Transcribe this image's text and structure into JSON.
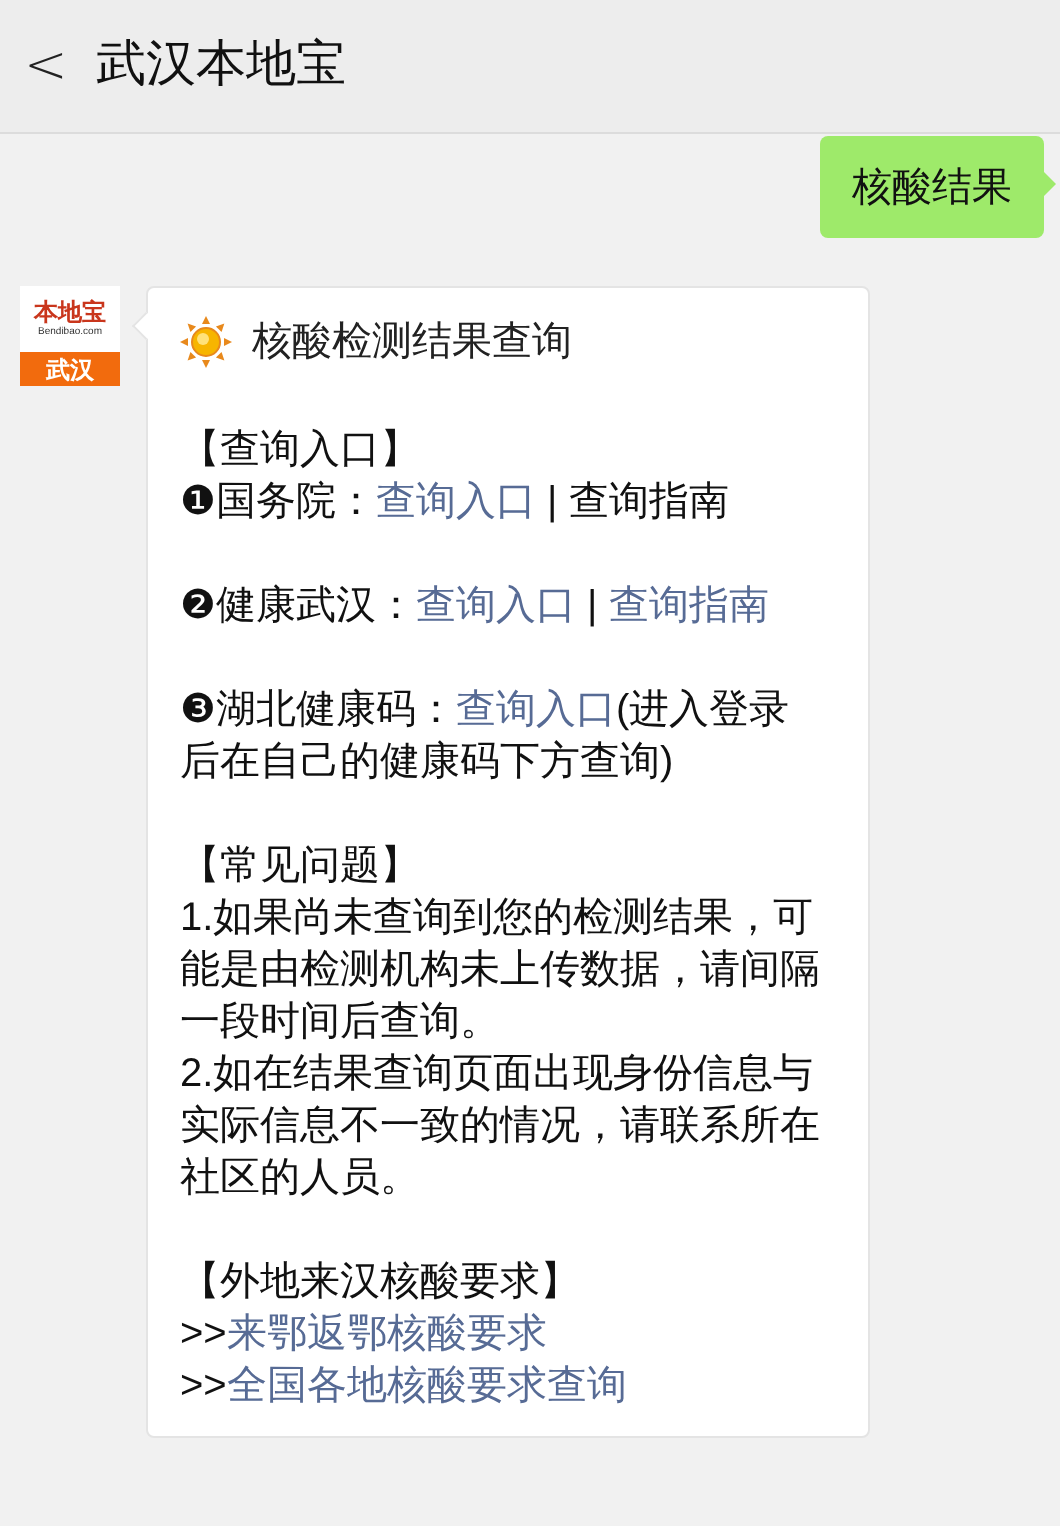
{
  "header": {
    "back": "<",
    "title": "武汉本地宝"
  },
  "messages": [
    {
      "kind": "outgoing",
      "text": "核酸结果"
    },
    {
      "kind": "incoming",
      "avatar": {
        "brand": "本地宝",
        "site": "Bendibao.com",
        "city": "武汉"
      },
      "title": "核酸检测结果查询",
      "blocks": [
        [
          [
            {
              "text": "【查询入口】",
              "link": false
            }
          ],
          [
            {
              "text": "❶国务院：",
              "link": false
            },
            {
              "text": "查询入口",
              "link": true
            },
            {
              "text": " | 查询指南",
              "link": false
            }
          ]
        ],
        [
          [
            {
              "text": "❷健康武汉：",
              "link": false
            },
            {
              "text": "查询入口",
              "link": true
            },
            {
              "text": " | ",
              "link": false
            },
            {
              "text": "查询指南",
              "link": true
            }
          ]
        ],
        [
          [
            {
              "text": "❸湖北健康码：",
              "link": false
            },
            {
              "text": "查询入口",
              "link": true
            },
            {
              "text": "(进入登录",
              "link": false
            }
          ],
          [
            {
              "text": "后在自己的健康码下方查询)",
              "link": false
            }
          ]
        ],
        [
          [
            {
              "text": "【常见问题】",
              "link": false
            }
          ],
          [
            {
              "text": "1.如果尚未查询到您的检测结果，可能是由检测机构未上传数据，请间隔一段时间后查询。",
              "link": false
            }
          ],
          [
            {
              "text": "2.如在结果查询页面出现身份信息与实际信息不一致的情况，请联系所在社区的人员。",
              "link": false
            }
          ]
        ],
        [
          [
            {
              "text": "【外地来汉核酸要求】",
              "link": false
            }
          ],
          [
            {
              "text": ">>",
              "link": false
            },
            {
              "text": "来鄂返鄂核酸要求",
              "link": true
            }
          ],
          [
            {
              "text": ">>",
              "link": false
            },
            {
              "text": "全国各地核酸要求查询",
              "link": true
            }
          ]
        ]
      ]
    }
  ]
}
